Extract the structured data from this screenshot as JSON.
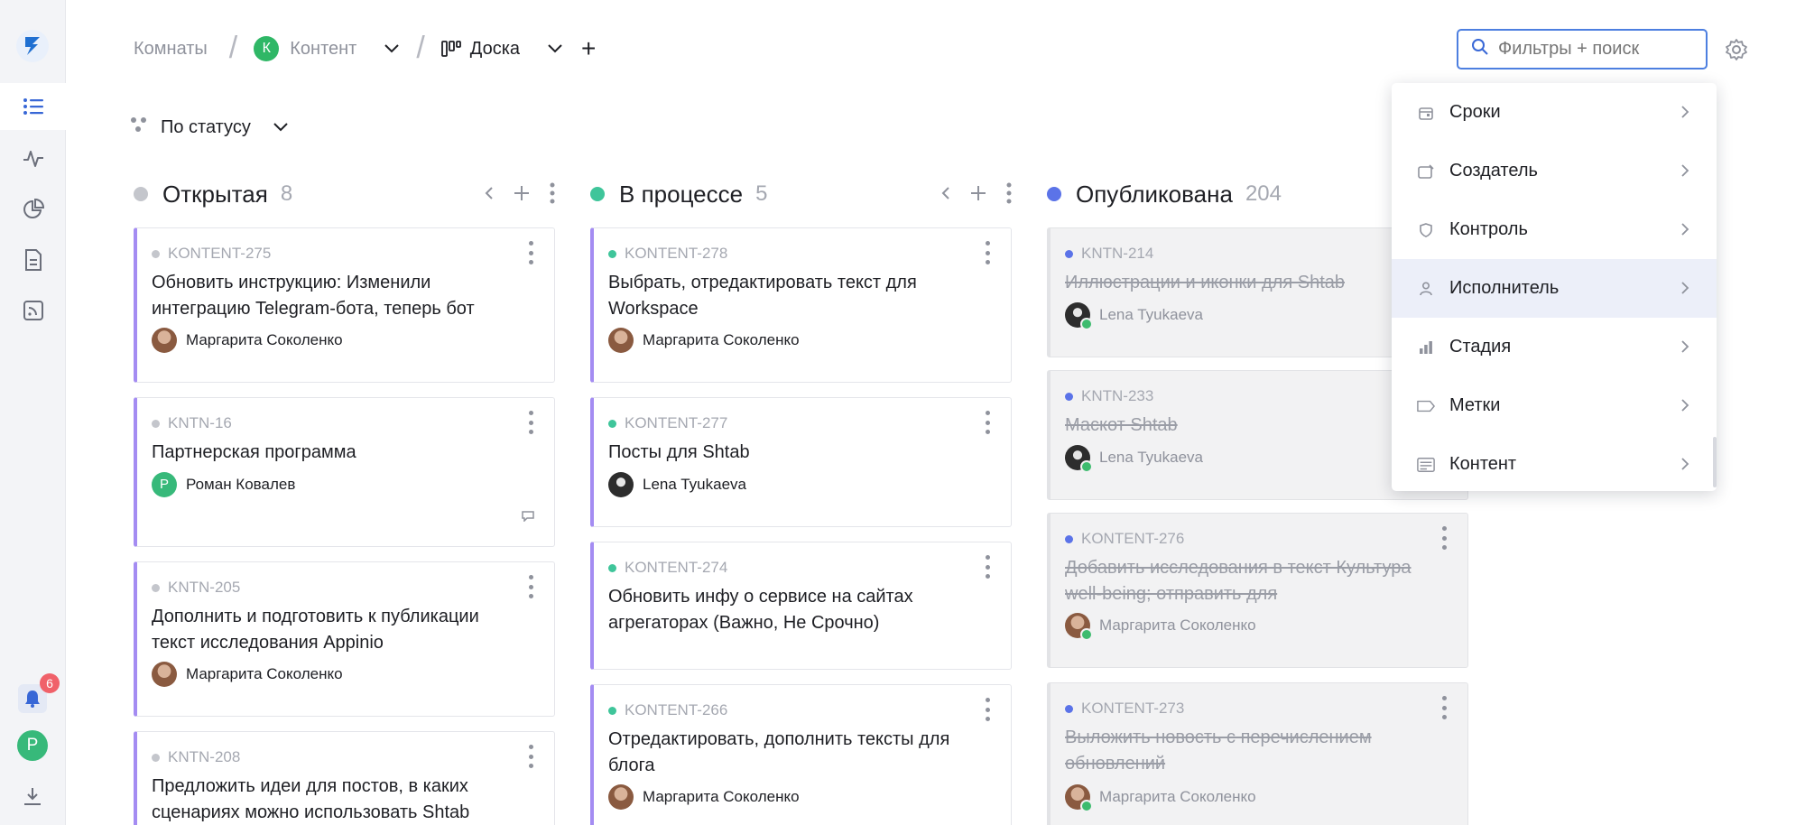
{
  "breadcrumbs": {
    "rooms": "Комнаты",
    "project_initial": "К",
    "project": "Контент",
    "view": "Доска"
  },
  "search": {
    "placeholder": "Фильтры + поиск"
  },
  "group_by": "По статусу",
  "notifications_count": "6",
  "user_initial": "Р",
  "columns": [
    {
      "title": "Открытая",
      "count": "8",
      "color": "#c4c6cc",
      "cards": [
        {
          "id": "KONTENT-275",
          "title": "Обновить инструкцию: Изменили интеграцию Telegram-бота, теперь бот",
          "user": "Маргарита Соколенко"
        },
        {
          "id": "KNTN-16",
          "title": "Партнерская программа",
          "user": "Роман Ковалев",
          "user_initial": "Р"
        },
        {
          "id": "KNTN-205",
          "title": "Дополнить и подготовить к публикации текст исследования Appinio",
          "user": "Маргарита Соколенко"
        },
        {
          "id": "KNTN-208",
          "title": "Предложить идеи для постов, в каких сценариях можно использовать Shtab",
          "user": ""
        }
      ]
    },
    {
      "title": "В процессе",
      "count": "5",
      "color": "#3fc59a",
      "cards": [
        {
          "id": "KONTENT-278",
          "title": "Выбрать, отредактировать текст для Workspace",
          "user": "Маргарита Соколенко"
        },
        {
          "id": "KONTENT-277",
          "title": "Посты для Shtab",
          "user": "Lena Tyukaeva"
        },
        {
          "id": "KONTENT-274",
          "title": "Обновить инфу о сервисе на сайтах агрегаторах (Важно, Не Срочно)",
          "user": ""
        },
        {
          "id": "KONTENT-266",
          "title": "Отредактировать, дополнить тексты для блога",
          "user": "Маргарита Соколенко"
        }
      ]
    },
    {
      "title": "Опубликована",
      "count": "204",
      "color": "#5b73e8",
      "cards": [
        {
          "id": "KNTN-214",
          "title": "Иллюстрации и иконки для Shtab",
          "user": "Lena Tyukaeva"
        },
        {
          "id": "KNTN-233",
          "title": "Маскот Shtab",
          "user": "Lena Tyukaeva"
        },
        {
          "id": "KONTENT-276",
          "title": "Добавить исследования в текст Культура well-being; отправить для",
          "user": "Маргарита Соколенко"
        },
        {
          "id": "KONTENT-273",
          "title": "Выложить новость с перечислением обновлений",
          "user": "Маргарита Соколенко"
        }
      ]
    }
  ],
  "filter_menu": [
    {
      "label": "Сроки",
      "icon": "calendar-icon"
    },
    {
      "label": "Создатель",
      "icon": "creator-icon"
    },
    {
      "label": "Контроль",
      "icon": "shield-icon"
    },
    {
      "label": "Исполнитель",
      "icon": "person-icon",
      "highlighted": true
    },
    {
      "label": "Стадия",
      "icon": "bar-chart-icon"
    },
    {
      "label": "Метки",
      "icon": "tag-icon"
    },
    {
      "label": "Контент",
      "icon": "document-icon"
    }
  ]
}
